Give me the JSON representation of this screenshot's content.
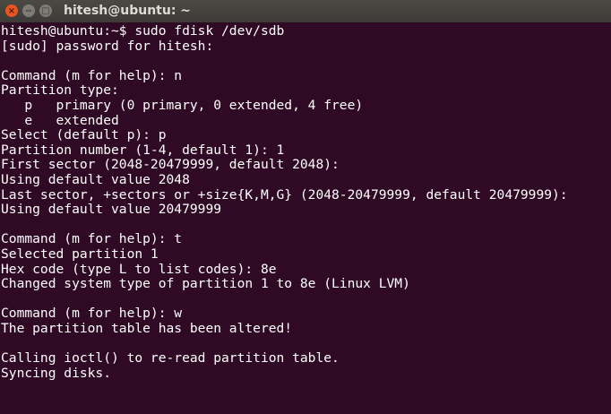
{
  "window": {
    "title": "hitesh@ubuntu: ~",
    "close_icon": "×",
    "minimize_icon": "−",
    "maximize_icon": "□"
  },
  "terminal": {
    "lines": [
      "hitesh@ubuntu:~$ sudo fdisk /dev/sdb",
      "[sudo] password for hitesh:",
      "",
      "Command (m for help): n",
      "Partition type:",
      "   p   primary (0 primary, 0 extended, 4 free)",
      "   e   extended",
      "Select (default p): p",
      "Partition number (1-4, default 1): 1",
      "First sector (2048-20479999, default 2048):",
      "Using default value 2048",
      "Last sector, +sectors or +size{K,M,G} (2048-20479999, default 20479999):",
      "Using default value 20479999",
      "",
      "Command (m for help): t",
      "Selected partition 1",
      "Hex code (type L to list codes): 8e",
      "Changed system type of partition 1 to 8e (Linux LVM)",
      "",
      "Command (m for help): w",
      "The partition table has been altered!",
      "",
      "Calling ioctl() to re-read partition table.",
      "Syncing disks."
    ]
  }
}
